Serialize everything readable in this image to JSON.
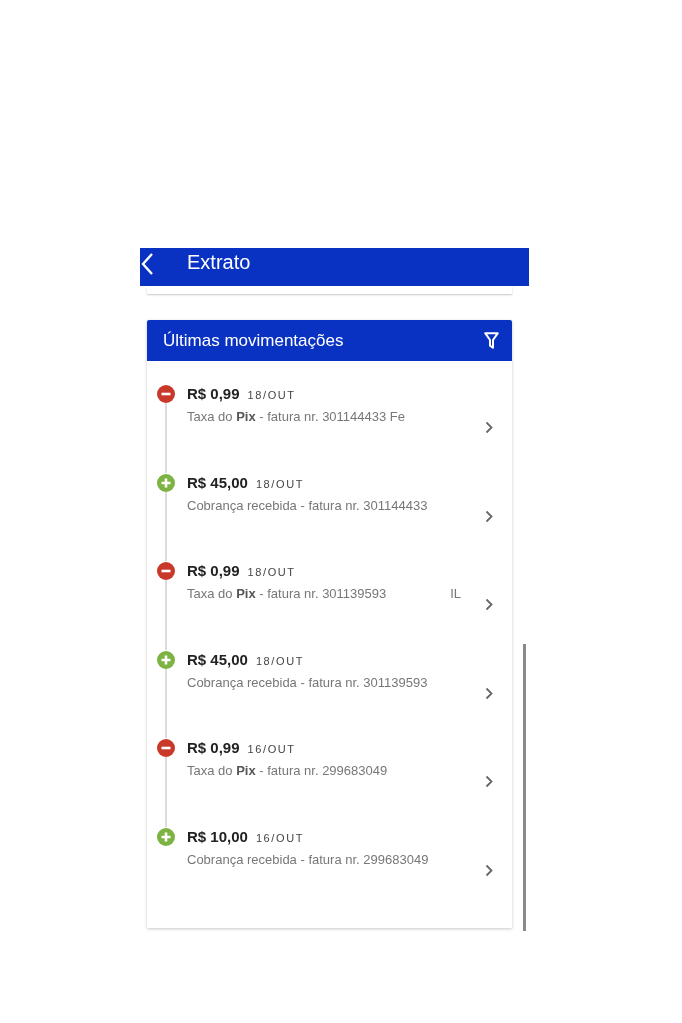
{
  "header": {
    "title": "Extrato"
  },
  "card": {
    "title": "Últimas movimentações"
  },
  "transactions": [
    {
      "kind": "debit",
      "amount": "R$ 0,99",
      "date": "18/OUT",
      "description": "Taxa do **Pix** - fatura nr. 301144433 Fe"
    },
    {
      "kind": "credit",
      "amount": "R$ 45,00",
      "date": "18/OUT",
      "description": "Cobrança recebida - fatura nr. 301144433"
    },
    {
      "kind": "debit",
      "amount": "R$ 0,99",
      "date": "18/OUT",
      "description": "Taxa do **Pix** - fatura nr. 301139593",
      "tail": "IL"
    },
    {
      "kind": "credit",
      "amount": "R$ 45,00",
      "date": "18/OUT",
      "description": "Cobrança recebida - fatura nr. 301139593"
    },
    {
      "kind": "debit",
      "amount": "R$ 0,99",
      "date": "16/OUT",
      "description": "Taxa do **Pix** - fatura nr. 299683049"
    },
    {
      "kind": "credit",
      "amount": "R$ 10,00",
      "date": "16/OUT",
      "description": "Cobrança recebida - fatura nr. 299683049"
    }
  ]
}
